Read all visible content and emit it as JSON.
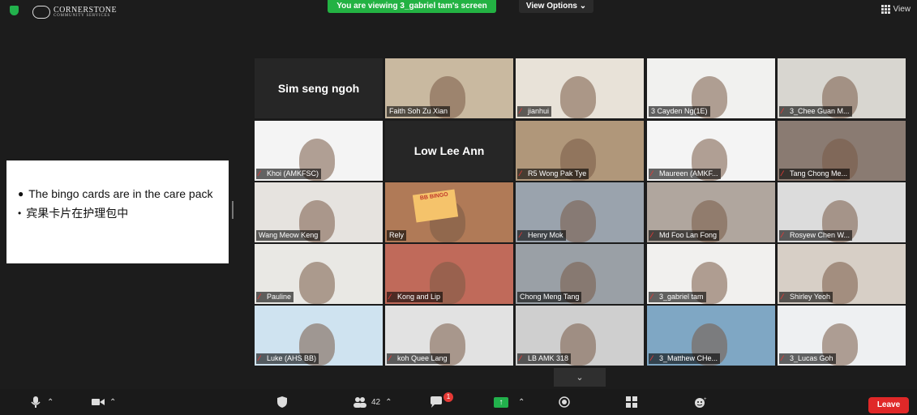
{
  "topbar": {
    "logo_text": "CORNERSTONE",
    "logo_sub": "COMMUNITY SERVICES",
    "banner": "You are viewing 3_gabriel tam's screen",
    "view_options": "View Options ⌄",
    "view": "View"
  },
  "shared_screen": {
    "line1": "The bingo cards are in the care pack",
    "line2": "宾果卡片在护理包中"
  },
  "participants": [
    {
      "name": "Sim seng ngoh",
      "type": "name"
    },
    {
      "name": "Faith Soh Zu Xian",
      "type": "video",
      "muted": false
    },
    {
      "name": "jianhui",
      "type": "video",
      "muted": true
    },
    {
      "name": "3 Cayden Ng(1E)",
      "type": "video",
      "muted": false
    },
    {
      "name": "3_Chee Guan M...",
      "type": "video",
      "muted": true
    },
    {
      "name": "Khoi (AMKFSC)",
      "type": "video",
      "muted": true
    },
    {
      "name": "Low Lee Ann",
      "type": "name"
    },
    {
      "name": "R5 Wong Pak Tye",
      "type": "video",
      "muted": true
    },
    {
      "name": "Maureen (AMKF...",
      "type": "video",
      "muted": true
    },
    {
      "name": "Tang Chong Me...",
      "type": "video",
      "muted": true
    },
    {
      "name": "Wang Meow Keng",
      "type": "video",
      "muted": false
    },
    {
      "name": "Rely",
      "type": "video",
      "muted": false
    },
    {
      "name": "Henry Mok",
      "type": "video",
      "muted": true
    },
    {
      "name": "Md Foo Lan Fong",
      "type": "video",
      "muted": true
    },
    {
      "name": "Rosyew Chen W...",
      "type": "video",
      "muted": true
    },
    {
      "name": "Pauline",
      "type": "video",
      "muted": true
    },
    {
      "name": "Kong and Lip",
      "type": "video",
      "muted": true
    },
    {
      "name": "Chong Meng Tang",
      "type": "video",
      "muted": false
    },
    {
      "name": "3_gabriel tam",
      "type": "video",
      "muted": true
    },
    {
      "name": "Shirley Yeoh",
      "type": "video",
      "muted": true
    },
    {
      "name": "Luke (AHS BB)",
      "type": "video",
      "muted": true
    },
    {
      "name": "koh Quee Lang",
      "type": "video",
      "muted": true
    },
    {
      "name": "LB AMK 318",
      "type": "video",
      "muted": true
    },
    {
      "name": "3_Matthew CHe...",
      "type": "video",
      "muted": true
    },
    {
      "name": "3_Lucas Goh",
      "type": "video",
      "muted": true
    }
  ],
  "tile_thumb": {
    "bingo": "BB BINGO"
  },
  "toolbar": {
    "participants_count": "42",
    "chat_badge": "1",
    "leave": "Leave"
  },
  "colors": {
    "banner": "#23b243",
    "leave": "#e02828",
    "active_speaker": "#c8e34a"
  }
}
